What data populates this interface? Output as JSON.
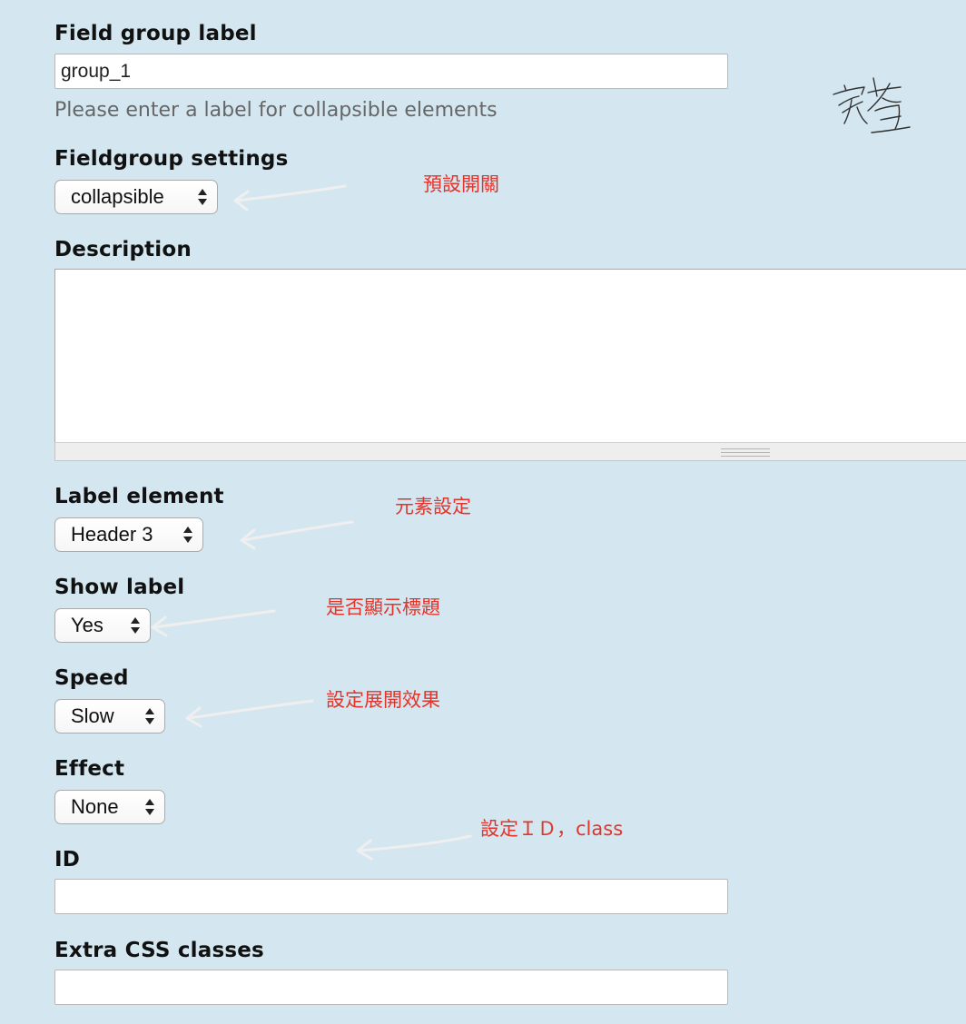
{
  "field_group_label": {
    "label": "Field group label",
    "value": "group_1",
    "help": "Please enter a label for collapsible elements"
  },
  "fieldgroup_settings": {
    "label": "Fieldgroup settings",
    "selected": "collapsible"
  },
  "description": {
    "label": "Description",
    "value": ""
  },
  "label_element": {
    "label": "Label element",
    "selected": "Header 3"
  },
  "show_label": {
    "label": "Show label",
    "selected": "Yes"
  },
  "speed": {
    "label": "Speed",
    "selected": "Slow"
  },
  "effect": {
    "label": "Effect",
    "selected": "None"
  },
  "id_field": {
    "label": "ID",
    "value": ""
  },
  "extra_css": {
    "label": "Extra CSS classes",
    "value": ""
  },
  "annotations": {
    "default_toggle": "預設開關",
    "element_setting": "元素設定",
    "show_title": "是否顯示標題",
    "expand_effect": "設定展開效果",
    "id_class": "設定ＩＤ，class",
    "color": "#e2342a"
  },
  "signature": "家杏"
}
